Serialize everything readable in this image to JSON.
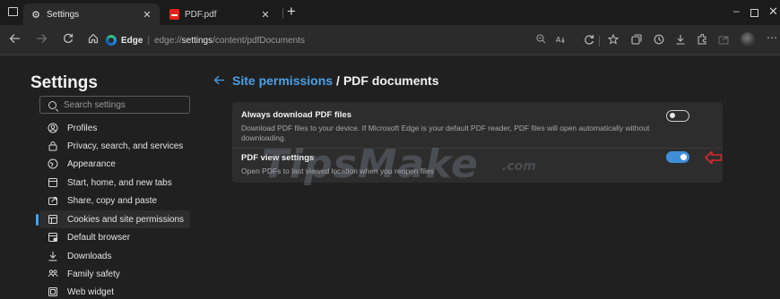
{
  "window": {
    "menu_icon": "window-menu-icon",
    "controls": {
      "minimize": "–",
      "close": "✕"
    }
  },
  "tabs": [
    {
      "label": "Settings",
      "icon": "gear-icon",
      "close": "✕"
    },
    {
      "label": "PDF.pdf",
      "icon": "pdf-icon",
      "close": "✕"
    }
  ],
  "new_tab": "+",
  "address_bar": {
    "site_name": "Edge",
    "separator": "|",
    "scheme": "edge://",
    "host": "settings",
    "path": "/content/pdfDocuments"
  },
  "sidebar": {
    "title": "Settings",
    "search_placeholder": "Search settings",
    "items": [
      {
        "label": "Profiles",
        "icon": "profile-icon",
        "selected": false
      },
      {
        "label": "Privacy, search, and services",
        "icon": "lock-icon",
        "selected": false
      },
      {
        "label": "Appearance",
        "icon": "appearance-icon",
        "selected": false
      },
      {
        "label": "Start, home, and new tabs",
        "icon": "start-icon",
        "selected": false
      },
      {
        "label": "Share, copy and paste",
        "icon": "share-icon",
        "selected": false
      },
      {
        "label": "Cookies and site permissions",
        "icon": "cookies-icon",
        "selected": true
      },
      {
        "label": "Default browser",
        "icon": "browser-icon",
        "selected": false
      },
      {
        "label": "Downloads",
        "icon": "download-icon",
        "selected": false
      },
      {
        "label": "Family safety",
        "icon": "family-icon",
        "selected": false
      },
      {
        "label": "Web widget",
        "icon": "widget-icon",
        "selected": false
      }
    ]
  },
  "page": {
    "breadcrumb_link": "Site permissions",
    "breadcrumb_sep": "/",
    "title": "PDF documents"
  },
  "settings": [
    {
      "title": "Always download PDF files",
      "description": "Download PDF files to your device. If Microsoft Edge is your default PDF reader, PDF files will open automatically without downloading.",
      "enabled": false
    },
    {
      "title": "PDF view settings",
      "description": "Open PDFs to last viewed location when you reopen files",
      "enabled": true
    }
  ],
  "watermark": {
    "text": "TipsMake",
    "suffix": ".com"
  },
  "colors": {
    "accent": "#4aa0e6",
    "toggle_on": "#3f8fd8",
    "annotation_arrow": "#e0262b",
    "background": "#202020",
    "card": "#2d2d2d"
  }
}
